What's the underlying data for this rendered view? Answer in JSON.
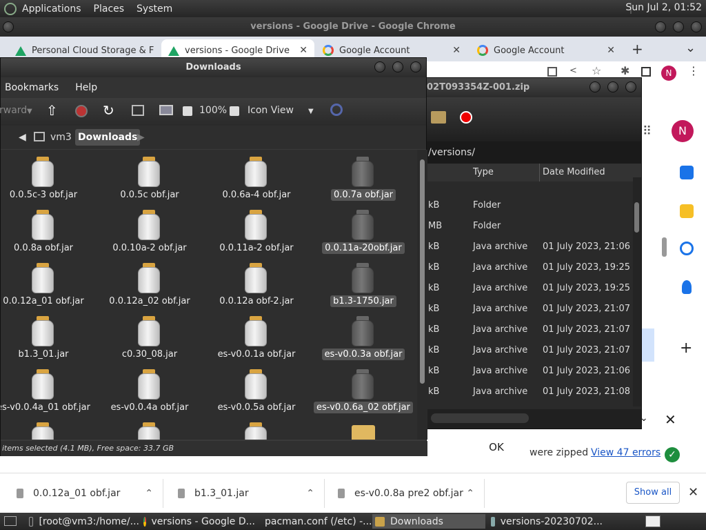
{
  "top_panel": {
    "menus": [
      "Applications",
      "Places",
      "System"
    ],
    "clock": "Sun Jul  2, 01:52"
  },
  "chrome": {
    "window_title": "versions - Google Drive - Google Chrome",
    "tabs": [
      {
        "label": "Personal Cloud Storage & F",
        "icon": "google-drive-icon",
        "active": false
      },
      {
        "label": "versions - Google Drive",
        "icon": "google-drive-icon",
        "active": true
      },
      {
        "label": "Google Account",
        "icon": "google-icon",
        "active": false
      },
      {
        "label": "Google Account",
        "icon": "google-icon",
        "active": false
      }
    ],
    "new_tab": "+",
    "tab_menu": "⌄",
    "close": "✕",
    "avatar_letter": "N"
  },
  "file_manager": {
    "title": "Downloads",
    "menus": [
      "Bookmarks",
      "Help"
    ],
    "toolbar": {
      "forward": "rward",
      "zoom": "100%",
      "view": "Icon View"
    },
    "path": [
      "vm3",
      "Downloads"
    ],
    "files": [
      {
        "name": "0.0.5c-3 obf.jar",
        "selected": false
      },
      {
        "name": "0.0.5c obf.jar",
        "selected": false
      },
      {
        "name": "0.0.6a-4 obf.jar",
        "selected": false
      },
      {
        "name": "0.0.7a obf.jar",
        "selected": true
      },
      {
        "name": "0.0.8a obf.jar",
        "selected": false
      },
      {
        "name": "0.0.10a-2 obf.jar",
        "selected": false
      },
      {
        "name": "0.0.11a-2 obf.jar",
        "selected": false
      },
      {
        "name": "0.0.11a-20obf.jar",
        "selected": true
      },
      {
        "name": "0.0.12a_01 obf.jar",
        "selected": false
      },
      {
        "name": "0.0.12a_02 obf.jar",
        "selected": false
      },
      {
        "name": "0.0.12a obf-2.jar",
        "selected": false
      },
      {
        "name": "b1.3-1750.jar",
        "selected": true
      },
      {
        "name": "b1.3_01.jar",
        "selected": false
      },
      {
        "name": "c0.30_08.jar",
        "selected": false
      },
      {
        "name": "es-v0.0.1a obf.jar",
        "selected": false
      },
      {
        "name": "es-v0.0.3a obf.jar",
        "selected": true
      },
      {
        "name": "es-v0.0.4a_01 obf.jar",
        "selected": false
      },
      {
        "name": "es-v0.0.4a obf.jar",
        "selected": false
      },
      {
        "name": "es-v0.0.5a obf.jar",
        "selected": false
      },
      {
        "name": "es-v0.0.6a_02 obf.jar",
        "selected": true
      }
    ],
    "status": "items selected (4.1 MB), Free space: 33.7 GB"
  },
  "archive": {
    "title": "02T093354Z-001.zip",
    "location": "/versions/",
    "columns": [
      "Type",
      "Date Modified"
    ],
    "rows": [
      {
        "size": "kB",
        "type": "Folder",
        "date": ""
      },
      {
        "size": "MB",
        "type": "Folder",
        "date": ""
      },
      {
        "size": "kB",
        "type": "Java archive",
        "date": "01 July 2023, 21:06"
      },
      {
        "size": "kB",
        "type": "Java archive",
        "date": "01 July 2023, 19:25"
      },
      {
        "size": "kB",
        "type": "Java archive",
        "date": "01 July 2023, 19:25"
      },
      {
        "size": "kB",
        "type": "Java archive",
        "date": "01 July 2023, 21:07"
      },
      {
        "size": "kB",
        "type": "Java archive",
        "date": "01 July 2023, 21:07"
      },
      {
        "size": "kB",
        "type": "Java archive",
        "date": "01 July 2023, 21:07"
      },
      {
        "size": "kB",
        "type": "Java archive",
        "date": "01 July 2023, 21:06"
      },
      {
        "size": "kB",
        "type": "Java archive",
        "date": "01 July 2023, 21:08"
      }
    ]
  },
  "dialog": {
    "ok": "OK",
    "zipped_text": "were zipped",
    "errors_link": "View 47 errors"
  },
  "downloads_bar": {
    "items": [
      "0.0.12a_01 obf.jar",
      "b1.3_01.jar",
      "es-v0.0.8a pre2 obf.jar"
    ],
    "show_all": "Show all",
    "close": "✕"
  },
  "taskbar": {
    "items": [
      {
        "label": "[root@vm3:/home/...",
        "icon": "terminal-icon"
      },
      {
        "label": "versions - Google D...",
        "icon": "chrome-icon"
      },
      {
        "label": "pacman.conf (/etc) -...",
        "icon": "text-editor-icon"
      },
      {
        "label": "Downloads",
        "icon": "folder-icon",
        "active": true
      },
      {
        "label": "versions-20230702...",
        "icon": "archive-icon"
      }
    ]
  }
}
